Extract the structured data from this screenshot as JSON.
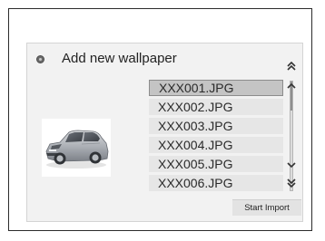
{
  "dialog": {
    "title": "Add new wallpaper",
    "title_icon": "gear-icon"
  },
  "preview": {
    "image": "car-thumbnail"
  },
  "files": [
    {
      "name": "XXX001.JPG",
      "selected": true
    },
    {
      "name": "XXX002.JPG",
      "selected": false
    },
    {
      "name": "XXX003.JPG",
      "selected": false
    },
    {
      "name": "XXX004.JPG",
      "selected": false
    },
    {
      "name": "XXX005.JPG",
      "selected": false
    },
    {
      "name": "XXX006.JPG",
      "selected": false
    }
  ],
  "scroll": {
    "page_up_icon": "double-chevron-up-icon",
    "line_up_icon": "chevron-up-icon",
    "line_down_icon": "chevron-down-icon",
    "page_down_icon": "double-chevron-down-icon"
  },
  "actions": {
    "start_import_label": "Start Import"
  },
  "colors": {
    "panel_bg": "#f2f2f2",
    "row_bg": "#e6e6e6",
    "selected_row_bg": "#c4c4c4",
    "border": "#2c2c2c"
  }
}
